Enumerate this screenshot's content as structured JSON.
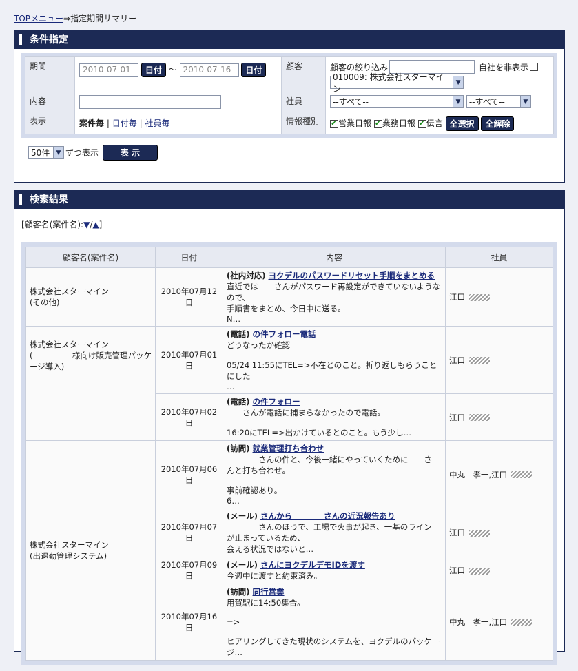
{
  "breadcrumb": {
    "top_link": "TOPメニュー",
    "arrow": "⇒",
    "current": "指定期間サマリー"
  },
  "condition_panel": {
    "title": "条件指定",
    "period_label": "期間",
    "date_from": "2010-07-01",
    "date_to": "2010-07-16",
    "date_button": "日付",
    "tilde": "～",
    "customer_label": "顧客",
    "customer_filter_label": "顧客の絞り込み",
    "hide_own_label": "自社を非表示",
    "customer_selected": "010009: 株式会社スターマイン",
    "content_label": "内容",
    "employee_label": "社員",
    "employee_sel1": "--すべて--",
    "employee_sel2": "--すべて--",
    "display_label": "表示",
    "display_modes": {
      "by_case": "案件毎",
      "by_date": "日付毎",
      "by_employee": "社員毎",
      "sep": "|"
    },
    "info_type_label": "情報種別",
    "info_types": [
      "営業日報",
      "業務日報",
      "伝言"
    ],
    "select_all": "全選択",
    "clear_all": "全解除",
    "per_page": "50件",
    "per_page_suffix": "ずつ表示",
    "show_button": "表 示"
  },
  "results_panel": {
    "title": "検索結果",
    "sort_label": "[顧客名(案件名):",
    "sort_desc": "▼",
    "sort_sep": "/",
    "sort_asc": "▲",
    "sort_close": "]",
    "columns": [
      "顧客名(案件名)",
      "日付",
      "内容",
      "社員"
    ],
    "groups": [
      {
        "customer": "株式会社スターマイン",
        "project": "(その他)",
        "rows": [
          {
            "date": "2010年07月12日",
            "tag": "(社内対応)",
            "title": "ヨクデルのパスワードリセット手順をまとめる",
            "body": [
              "直近では　　さんがパスワード再設定ができていないような",
              "ので、",
              "手順書をまとめ、今日中に送る。",
              "N…"
            ],
            "employee": "江口"
          }
        ]
      },
      {
        "customer": "株式会社スターマイン",
        "project": "(　　　　　様向け販売管理パッケージ導入)",
        "rows": [
          {
            "date": "2010年07月01日",
            "tag": "(電話)",
            "title": "の件フォロー電話",
            "body": [
              "どうなったか確認",
              "",
              "05/24 11:55にTEL=>不在とのこと。折り返しもらうことにした",
              "…"
            ],
            "employee": "江口"
          },
          {
            "date": "2010年07月02日",
            "tag": "(電話)",
            "title": "の件フォロー",
            "body": [
              "　　さんが電話に捕まらなかったので電話。",
              "",
              "16:20にTEL=>出かけているとのこと。もう少し…"
            ],
            "employee": "江口"
          }
        ]
      },
      {
        "customer": "株式会社スターマイン",
        "project": "(出退勤管理システム)",
        "rows": [
          {
            "date": "2010年07月06日",
            "tag": "(訪問)",
            "title": "就業管理打ち合わせ",
            "body": [
              "　　　　さんの件と、今後一緒にやっていくために　　さ",
              "んと打ち合わせ。",
              "",
              "事前確認あり。",
              "6…"
            ],
            "employee": "中丸　孝一,江口"
          },
          {
            "date": "2010年07月07日",
            "tag": "(メール)",
            "title": "さんから　　　　さんの近況報告あり",
            "body": [
              "　　　　さんのほうで、工場で火事が起き、一基のライン",
              "が止まっているため、",
              "会える状況ではないと…"
            ],
            "employee": "江口"
          },
          {
            "date": "2010年07月09日",
            "tag": "(メール)",
            "title": "さんにヨクデルデモIDを渡す",
            "body": [
              "今週中に渡すと約束済み。"
            ],
            "employee": "江口"
          },
          {
            "date": "2010年07月16日",
            "tag": "(訪問)",
            "title": "同行営業",
            "body": [
              "用賀駅に14:50集合。",
              "",
              "=>",
              "",
              "ヒアリングしてきた現状のシステムを、ヨクデルのパッケー",
              "ジ…"
            ],
            "employee": "中丸　孝一,江口"
          }
        ]
      }
    ]
  }
}
